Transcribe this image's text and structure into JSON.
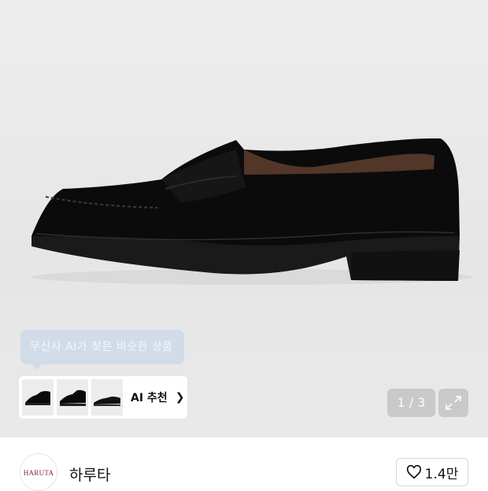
{
  "ai_tooltip": {
    "text": "무신사 AI가 찾은 비슷한 상품"
  },
  "ai_recommend": {
    "label": "AI 추천",
    "thumbnails": [
      "loafer-black-suede",
      "loafer-black-leather",
      "loafer-black-leather-flat"
    ]
  },
  "pager": {
    "text": "1 / 3"
  },
  "brand": {
    "name": "하루타",
    "logo_text": "HARUTA"
  },
  "like": {
    "count": "1.4만"
  },
  "colors": {
    "hero_bg": "#ebebeb",
    "tooltip_bg": "#cfdbe9",
    "logo_accent": "#7b1f3a"
  }
}
